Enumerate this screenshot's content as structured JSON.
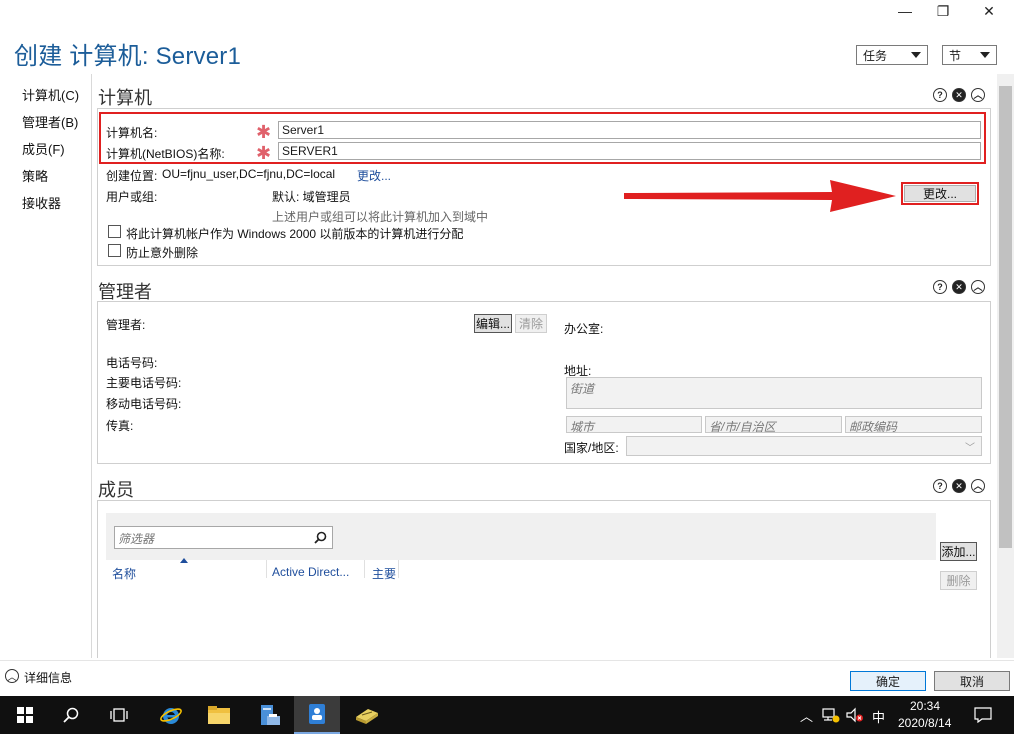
{
  "window": {
    "title": "创建 计算机: Server1",
    "tasks_label": "任务",
    "sections_label": "节"
  },
  "nav": {
    "items": [
      {
        "label": "计算机(C)"
      },
      {
        "label": "管理者(B)"
      },
      {
        "label": "成员(F)"
      },
      {
        "label": "策略"
      },
      {
        "label": "接收器"
      }
    ]
  },
  "computer": {
    "title": "计算机",
    "name_label": "计算机名:",
    "name_value": "Server1",
    "netbios_label": "计算机(NetBIOS)名称:",
    "netbios_value": "SERVER1",
    "location_label": "创建位置:",
    "location_value": "OU=fjnu_user,DC=fjnu,DC=local",
    "location_change": "更改...",
    "usergroup_label": "用户或组:",
    "usergroup_value": "默认: 域管理员",
    "usergroup_hint": "上述用户或组可以将此计算机加入到域中",
    "change_button": "更改...",
    "pre2000_label": "将此计算机帐户作为 Windows 2000 以前版本的计算机进行分配",
    "protect_label": "防止意外删除"
  },
  "manager": {
    "title": "管理者",
    "manager_label": "管理者:",
    "edit_button": "编辑...",
    "clear_button": "清除",
    "office_label": "办公室:",
    "phone_label": "电话号码:",
    "main_phone_label": "主要电话号码:",
    "mobile_label": "移动电话号码:",
    "fax_label": "传真:",
    "address_label": "地址:",
    "street_placeholder": "街道",
    "city_placeholder": "城市",
    "state_placeholder": "省/市/自治区",
    "zip_placeholder": "邮政编码",
    "country_label": "国家/地区:"
  },
  "members": {
    "title": "成员",
    "filter_placeholder": "筛选器",
    "columns": [
      "名称",
      "Active Direct...",
      "主要"
    ],
    "add_button": "添加...",
    "remove_button": "删除"
  },
  "footer": {
    "details_label": "详细信息",
    "ok_button": "确定",
    "cancel_button": "取消"
  },
  "taskbar": {
    "time": "20:34",
    "date": "2020/8/14",
    "ime": "中"
  },
  "colors": {
    "title": "#1c5d99",
    "required": "#e0616b",
    "highlight": "#e02020",
    "link": "#1f4e9c"
  }
}
